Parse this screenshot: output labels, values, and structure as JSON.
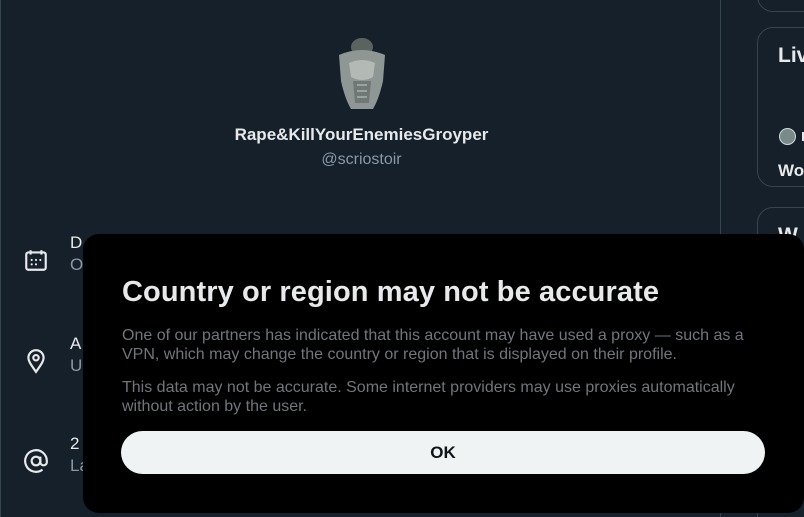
{
  "profile": {
    "display_name": "Rape&KillYourEnemiesGroyper",
    "handle": "@scriostoir"
  },
  "info_rows": [
    {
      "icon": "calendar-icon",
      "line1": "D",
      "line2": "O"
    },
    {
      "icon": "location-pin-icon",
      "line1": "A",
      "line2": "U"
    },
    {
      "icon": "at-sign-icon",
      "line1": "2",
      "line2": "La"
    }
  ],
  "right_sidebar": {
    "live_title": "Liv",
    "live_text": "Wo",
    "who_title": "W"
  },
  "modal": {
    "title": "Country or region may not be accurate",
    "paragraph1": "One of our partners has indicated that this account may have used a proxy — such as a VPN, which may change the country or region that is displayed on their profile.",
    "paragraph2": "This data may not be accurate. Some internet providers may use proxies automatically without action by the user.",
    "ok_label": "OK"
  },
  "colors": {
    "background": "#15202b",
    "modal_background": "#000000",
    "button_background": "#eff3f4",
    "muted_text": "#71767b"
  }
}
